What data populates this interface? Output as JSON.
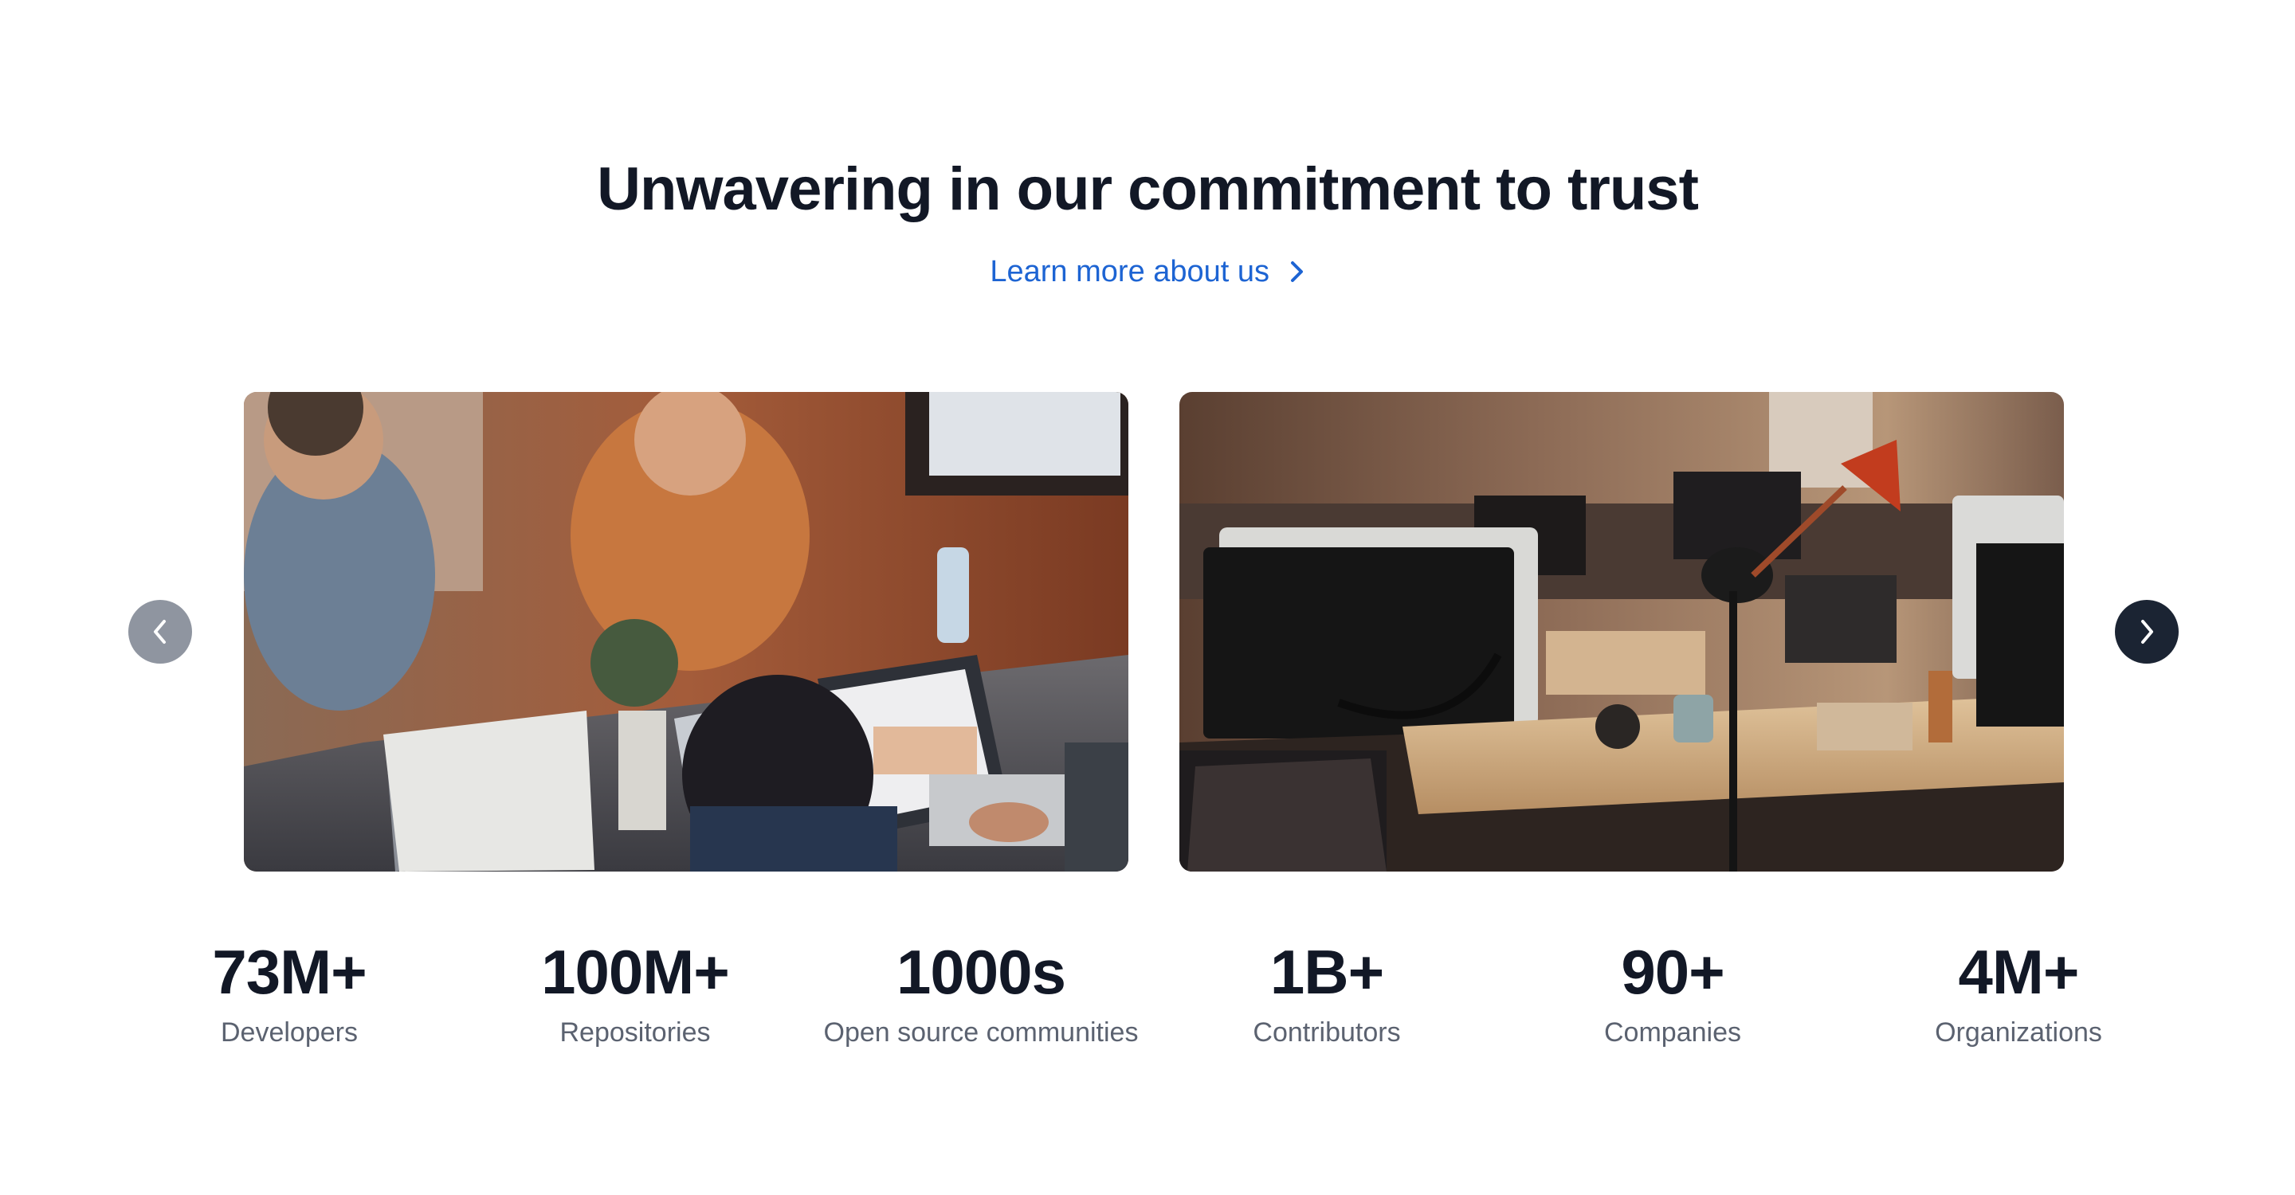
{
  "section": {
    "heading": "Unwavering in our commitment to trust",
    "link_label": "Learn more about us"
  },
  "carousel": {
    "prev_icon": "chevron-left-icon",
    "next_icon": "chevron-right-icon",
    "slides": [
      {
        "description_icon": "team-working-on-laptops-photo"
      },
      {
        "description_icon": "empty-office-desks-photo"
      }
    ]
  },
  "stats": [
    {
      "value": "73M+",
      "label": "Developers"
    },
    {
      "value": "100M+",
      "label": "Repositories"
    },
    {
      "value": "1000s",
      "label": "Open source communities"
    },
    {
      "value": "1B+",
      "label": "Contributors"
    },
    {
      "value": "90+",
      "label": "Companies"
    },
    {
      "value": "4M+",
      "label": "Organizations"
    }
  ],
  "colors": {
    "heading": "#121826",
    "link": "#1d64d3",
    "prev_button": "#8f95a0",
    "next_button": "#1b2433",
    "stat_label": "#5b6270"
  }
}
